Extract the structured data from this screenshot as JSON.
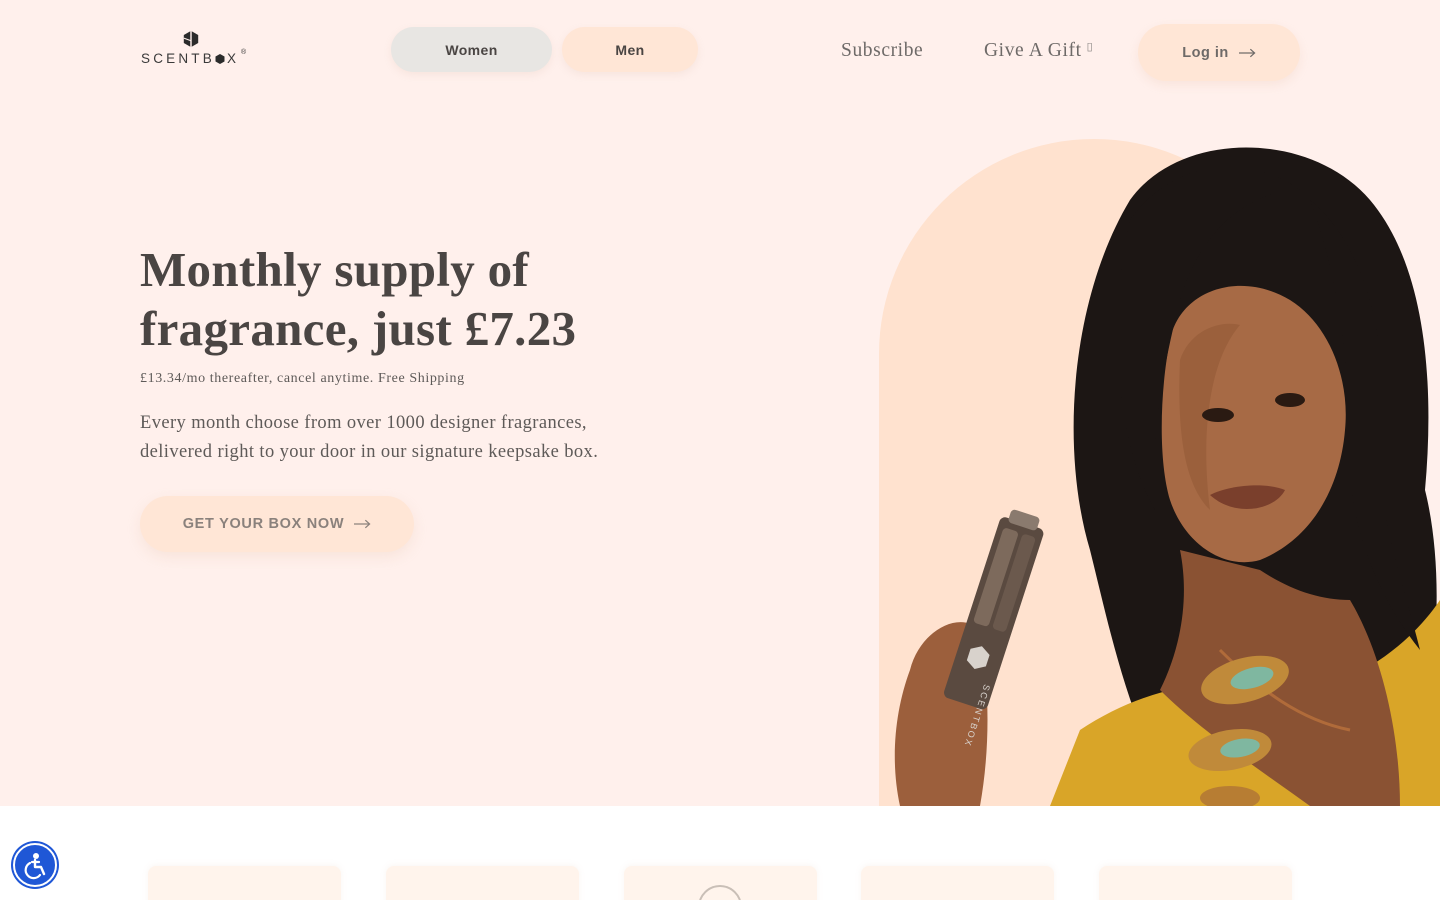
{
  "header": {
    "logo_text": "SCENTB",
    "logo_text_end": "X",
    "logo_reg": "®",
    "tabs": [
      {
        "label": "Women"
      },
      {
        "label": "Men"
      }
    ],
    "nav": {
      "subscribe": "Subscribe",
      "gift": "Give A Gift",
      "gift_icon": "gift-icon"
    },
    "login_label": "Log in"
  },
  "hero": {
    "headline_line1": "Monthly supply of",
    "headline_line2": "fragrance, just £7.23",
    "subline": "£13.34/mo thereafter, cancel anytime. Free Shipping",
    "desc_line1": "Every month choose from over 1000 designer fragrances,",
    "desc_line2": "delivered right to your door in our signature keepsake box.",
    "cta_label": "GET YOUR BOX NOW",
    "photo_label": "SCENTBOX"
  },
  "colors": {
    "hero_bg": "#fff0ec",
    "accent_peach": "#ffe6d6",
    "text_dark": "#4a4543",
    "a11y_blue": "#1f57d6"
  },
  "accessibility": {
    "icon": "accessibility-icon"
  }
}
